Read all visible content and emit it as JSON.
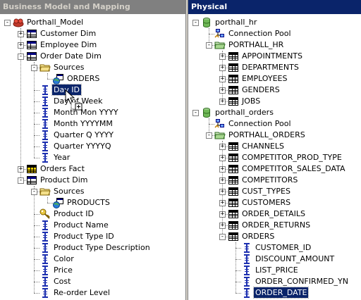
{
  "left_panel": {
    "title": "Business Model and Mapping",
    "items": [
      {
        "label": "Porthall_Model",
        "depth": 0,
        "icon": "business-model-icon",
        "expander": "-"
      },
      {
        "label": "Customer Dim",
        "depth": 1,
        "icon": "logical-table-icon",
        "expander": "+"
      },
      {
        "label": "Employee Dim",
        "depth": 1,
        "icon": "logical-table-icon",
        "expander": "+"
      },
      {
        "label": "Order Date Dim",
        "depth": 1,
        "icon": "logical-table-icon",
        "expander": "-"
      },
      {
        "label": "Sources",
        "depth": 2,
        "icon": "folder-icon",
        "expander": "-"
      },
      {
        "label": "ORDERS",
        "depth": 3,
        "icon": "logical-table-source-icon",
        "expander": ""
      },
      {
        "label": "Day ID",
        "depth": 2,
        "icon": "column-icon",
        "expander": "",
        "selected": true
      },
      {
        "label": "Day of Week",
        "depth": 2,
        "icon": "column-icon",
        "expander": ""
      },
      {
        "label": "Month Mon YYYY",
        "depth": 2,
        "icon": "column-icon",
        "expander": ""
      },
      {
        "label": "Month YYYYMM",
        "depth": 2,
        "icon": "column-icon",
        "expander": ""
      },
      {
        "label": "Quarter Q YYYY",
        "depth": 2,
        "icon": "column-icon",
        "expander": ""
      },
      {
        "label": "Quarter YYYYQ",
        "depth": 2,
        "icon": "column-icon",
        "expander": ""
      },
      {
        "label": "Year",
        "depth": 2,
        "icon": "column-icon",
        "expander": ""
      },
      {
        "label": "Orders Fact",
        "depth": 1,
        "icon": "fact-table-icon",
        "expander": "+"
      },
      {
        "label": "Product Dim",
        "depth": 1,
        "icon": "logical-table-icon",
        "expander": "-"
      },
      {
        "label": "Sources",
        "depth": 2,
        "icon": "folder-icon",
        "expander": "-"
      },
      {
        "label": "PRODUCTS",
        "depth": 3,
        "icon": "logical-table-source-icon",
        "expander": ""
      },
      {
        "label": "Product ID",
        "depth": 2,
        "icon": "key-icon",
        "expander": ""
      },
      {
        "label": "Product Name",
        "depth": 2,
        "icon": "column-icon",
        "expander": ""
      },
      {
        "label": "Product Type ID",
        "depth": 2,
        "icon": "column-icon",
        "expander": ""
      },
      {
        "label": "Product Type Description",
        "depth": 2,
        "icon": "column-icon",
        "expander": ""
      },
      {
        "label": "Color",
        "depth": 2,
        "icon": "column-icon",
        "expander": ""
      },
      {
        "label": "Price",
        "depth": 2,
        "icon": "column-icon",
        "expander": ""
      },
      {
        "label": "Cost",
        "depth": 2,
        "icon": "column-icon",
        "expander": ""
      },
      {
        "label": "Re-order Level",
        "depth": 2,
        "icon": "column-icon",
        "expander": ""
      }
    ]
  },
  "right_panel": {
    "title": "Physical",
    "items": [
      {
        "label": "porthall_hr",
        "depth": 0,
        "icon": "database-icon",
        "expander": "-"
      },
      {
        "label": "Connection Pool",
        "depth": 1,
        "icon": "connection-pool-icon",
        "expander": ""
      },
      {
        "label": "PORTHALL_HR",
        "depth": 1,
        "icon": "schema-folder-icon",
        "expander": "-"
      },
      {
        "label": "APPOINTMENTS",
        "depth": 2,
        "icon": "table-icon",
        "expander": "+"
      },
      {
        "label": "DEPARTMENTS",
        "depth": 2,
        "icon": "table-icon",
        "expander": "+"
      },
      {
        "label": "EMPLOYEES",
        "depth": 2,
        "icon": "table-icon",
        "expander": "+"
      },
      {
        "label": "GENDERS",
        "depth": 2,
        "icon": "table-icon",
        "expander": "+"
      },
      {
        "label": "JOBS",
        "depth": 2,
        "icon": "table-icon",
        "expander": "+"
      },
      {
        "label": "porthall_orders",
        "depth": 0,
        "icon": "database-icon",
        "expander": "-"
      },
      {
        "label": "Connection Pool",
        "depth": 1,
        "icon": "connection-pool-icon",
        "expander": ""
      },
      {
        "label": "PORTHALL_ORDERS",
        "depth": 1,
        "icon": "schema-folder-icon",
        "expander": "-"
      },
      {
        "label": "CHANNELS",
        "depth": 2,
        "icon": "table-icon",
        "expander": "+"
      },
      {
        "label": "COMPETITOR_PROD_TYPE",
        "depth": 2,
        "icon": "table-icon",
        "expander": "+"
      },
      {
        "label": "COMPETITOR_SALES_DATA",
        "depth": 2,
        "icon": "table-icon",
        "expander": "+"
      },
      {
        "label": "COMPETITORS",
        "depth": 2,
        "icon": "table-icon",
        "expander": "+"
      },
      {
        "label": "CUST_TYPES",
        "depth": 2,
        "icon": "table-icon",
        "expander": "+"
      },
      {
        "label": "CUSTOMERS",
        "depth": 2,
        "icon": "table-icon",
        "expander": "+"
      },
      {
        "label": "ORDER_DETAILS",
        "depth": 2,
        "icon": "table-icon",
        "expander": "+"
      },
      {
        "label": "ORDER_RETURNS",
        "depth": 2,
        "icon": "table-icon",
        "expander": "+"
      },
      {
        "label": "ORDERS",
        "depth": 2,
        "icon": "table-icon",
        "expander": "-"
      },
      {
        "label": "CUSTOMER_ID",
        "depth": 3,
        "icon": "column-icon",
        "expander": ""
      },
      {
        "label": "DISCOUNT_AMOUNT",
        "depth": 3,
        "icon": "column-icon",
        "expander": ""
      },
      {
        "label": "LIST_PRICE",
        "depth": 3,
        "icon": "column-icon",
        "expander": ""
      },
      {
        "label": "ORDER_CONFIRMED_YN",
        "depth": 3,
        "icon": "column-icon",
        "expander": ""
      },
      {
        "label": "ORDER_DATE",
        "depth": 3,
        "icon": "column-icon",
        "expander": "",
        "selected": true
      }
    ]
  },
  "colors": {
    "selection": "#0a246a",
    "inactive_title": "#808080",
    "active_title": "#0a246a",
    "column_icon": "#1c2fb0"
  }
}
